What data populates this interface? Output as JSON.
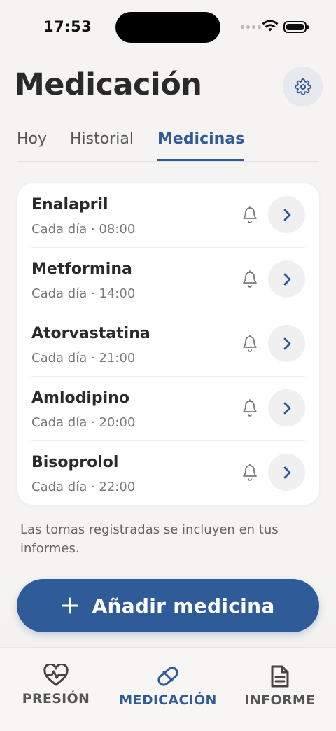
{
  "status_bar": {
    "time": "17:53"
  },
  "header": {
    "title": "Medicación",
    "settings_icon": "gear-icon"
  },
  "tabs": [
    {
      "label": "Hoy",
      "active": false
    },
    {
      "label": "Historial",
      "active": false
    },
    {
      "label": "Medicinas",
      "active": true
    }
  ],
  "medicines": [
    {
      "name": "Enalapril",
      "schedule": "Cada día · 08:00"
    },
    {
      "name": "Metformina",
      "schedule": "Cada día · 14:00"
    },
    {
      "name": "Atorvastatina",
      "schedule": "Cada día · 21:00"
    },
    {
      "name": "Amlodipino",
      "schedule": "Cada día · 20:00"
    },
    {
      "name": "Bisoprolol",
      "schedule": "Cada día · 22:00"
    }
  ],
  "footnote": "Las tomas registradas se incluyen en tus informes.",
  "add_button": {
    "label": "Añadir medicina",
    "icon": "plus-icon"
  },
  "bottom_nav": [
    {
      "label": "PRESIÓN",
      "icon": "heart-pulse-icon",
      "active": false
    },
    {
      "label": "MEDICACIÓN",
      "icon": "pill-icon",
      "active": true
    },
    {
      "label": "INFORME",
      "icon": "document-icon",
      "active": false
    }
  ],
  "colors": {
    "accent": "#2f5b98",
    "background": "#f5f4f2",
    "card": "#ffffff"
  }
}
